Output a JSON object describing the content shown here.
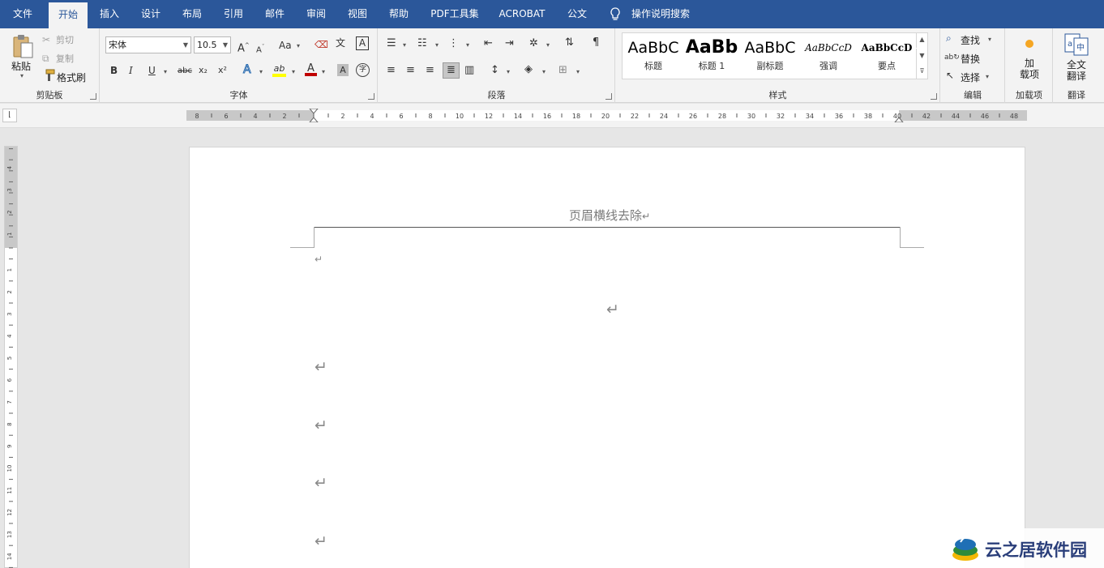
{
  "tabs": [
    "文件",
    "开始",
    "插入",
    "设计",
    "布局",
    "引用",
    "邮件",
    "审阅",
    "视图",
    "帮助",
    "PDF工具集",
    "ACROBAT",
    "公文"
  ],
  "active_tab": "开始",
  "search_label": "操作说明搜索",
  "clipboard": {
    "paste_label": "粘贴",
    "cut_label": "剪切",
    "copy_label": "复制",
    "format_painter_label": "格式刷",
    "group_label": "剪贴板"
  },
  "font": {
    "font_name": "宋体",
    "font_size": "10.5",
    "grow_label": "A",
    "shrink_label": "A",
    "case_label": "Aa",
    "phonetic_label": "文",
    "border_label": "A",
    "bold": "B",
    "italic": "I",
    "underline": "U",
    "strike": "abc",
    "subscript": "x₂",
    "superscript": "x²",
    "effects": "A",
    "highlight": "ab",
    "color": "A",
    "shading": "A",
    "enclose": "字",
    "group_label": "字体",
    "highlight_color": "#ffff00",
    "font_color": "#c00000"
  },
  "paragraph": {
    "group_label": "段落"
  },
  "styles": {
    "items": [
      {
        "sample": "AaBbC",
        "name": "标题"
      },
      {
        "sample": "AaBb",
        "name": "标题 1"
      },
      {
        "sample": "AaBbC",
        "name": "副标题"
      },
      {
        "sample": "AaBbCcD",
        "name": "强调"
      },
      {
        "sample": "AaBbCcD",
        "name": "要点"
      }
    ],
    "group_label": "样式"
  },
  "editing": {
    "find_label": "查找",
    "replace_label": "替换",
    "select_label": "选择",
    "group_label": "编辑"
  },
  "addins": {
    "button_line1": "加",
    "button_line2": "载项",
    "group_label": "加载项",
    "dot_color": "#f5a623"
  },
  "translate": {
    "button_line1": "全文",
    "button_line2": "翻译",
    "group_label": "翻译"
  },
  "ruler": {
    "horizontal_labels": [
      "8",
      "6",
      "4",
      "2",
      "2",
      "4",
      "6",
      "8",
      "10",
      "12",
      "14",
      "16",
      "18",
      "20",
      "22",
      "24",
      "26",
      "28",
      "30",
      "32",
      "34",
      "36",
      "38",
      "40",
      "42",
      "44",
      "46",
      "48"
    ],
    "vertical_labels": [
      "4",
      "3",
      "2",
      "1",
      "1",
      "2",
      "3",
      "4",
      "5",
      "6",
      "7",
      "8",
      "9",
      "10",
      "11",
      "12",
      "13",
      "14"
    ]
  },
  "document": {
    "header_text": "页眉横线去除",
    "paragraph_mark": "↵"
  },
  "watermark": {
    "text": "云之居软件园"
  },
  "colors": {
    "ribbon_tab_bar": "#2b579a",
    "ribbon_body": "#f3f3f3",
    "canvas": "#e6e6e6"
  }
}
